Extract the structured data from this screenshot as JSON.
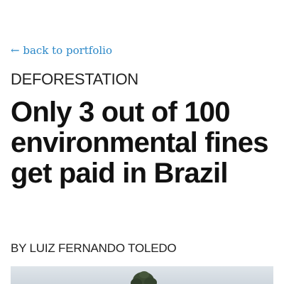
{
  "nav": {
    "back_link": "← back to portfolio"
  },
  "article": {
    "category": "DEFORESTATION",
    "headline": "Only 3 out of 100 environmental fines get paid in Brazil",
    "byline": "BY LUIZ FERNANDO TOLEDO"
  },
  "colors": {
    "link": "#2a87c7",
    "text": "#111111"
  }
}
